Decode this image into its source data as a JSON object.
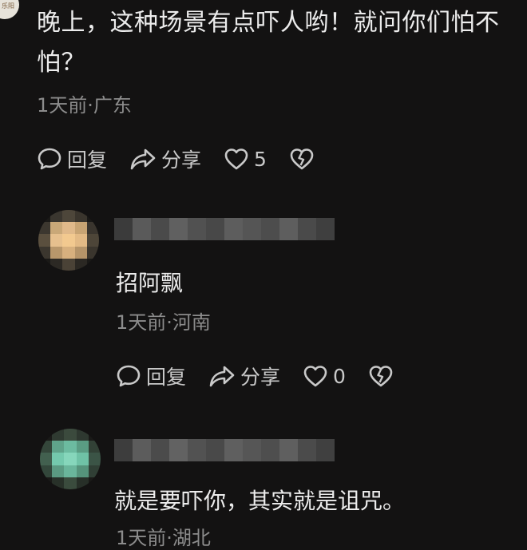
{
  "colors": {
    "background": "#131212",
    "text": "#ececec",
    "meta": "#8c8c8c",
    "action": "#c9c9c9"
  },
  "top_avatar_label": "乐阳",
  "main_comment": {
    "text": "晚上，这种场景有点吓人哟！就问你们怕不怕？",
    "meta": "1天前·广东",
    "actions": {
      "reply": "回复",
      "share": "分享",
      "likes": "5"
    }
  },
  "replies": [
    {
      "text": "招阿飘",
      "meta": "1天前·河南",
      "actions": {
        "reply": "回复",
        "share": "分享",
        "likes": "0"
      }
    },
    {
      "text": "就是要吓你，其实就是诅咒。",
      "meta": "1天前·湖北"
    }
  ],
  "icons": [
    "comment-icon",
    "share-icon",
    "heart-icon",
    "broken-heart-icon"
  ]
}
